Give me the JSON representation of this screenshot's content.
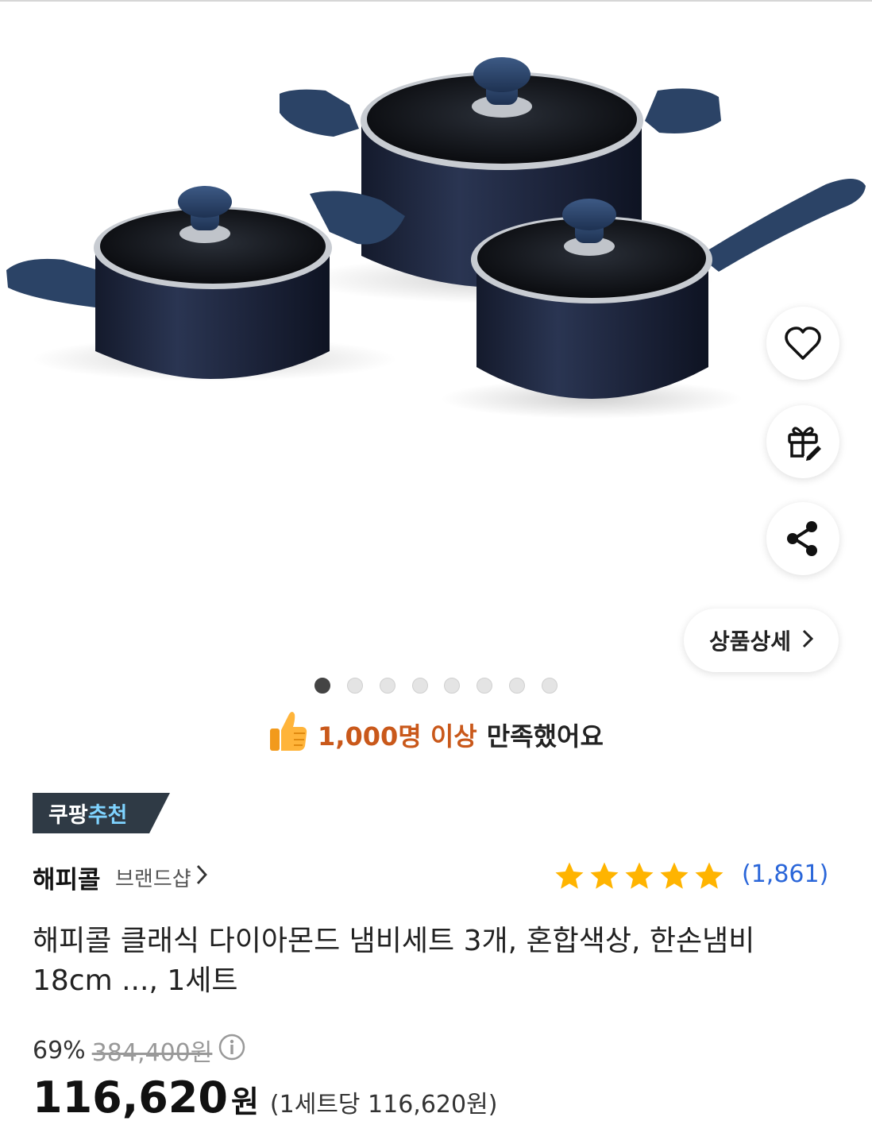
{
  "gallery": {
    "image_alt": "cookware set",
    "detail_button_label": "상품상세",
    "dots_total": 8,
    "dots_active_index": 0
  },
  "actions": {
    "wishlist_icon": "heart-icon",
    "gift_icon": "gift-icon",
    "share_icon": "share-icon"
  },
  "satisfaction": {
    "highlight": "1,000명 이상",
    "rest": "만족했어요"
  },
  "badge": {
    "part1": "쿠팡",
    "part2": "추천"
  },
  "brand": {
    "name": "해피콜",
    "shop_label": "브랜드샵"
  },
  "rating": {
    "stars": 5,
    "count": "(1,861)"
  },
  "product": {
    "title": "해피콜 클래식 다이아몬드 냄비세트 3개, 혼합색상, 한손냄비 18cm ..., 1세트"
  },
  "price": {
    "discount": "69%",
    "original": "384,400원",
    "current": "116,620",
    "currency": "원",
    "per_unit": "(1세트당 116,620원)"
  },
  "colors": {
    "pot_body": "#1e2740",
    "accent_blue": "#2a66d9",
    "discount_orange": "#c9581a",
    "badge_bg": "#2f3a45",
    "star": "#ffb400"
  }
}
